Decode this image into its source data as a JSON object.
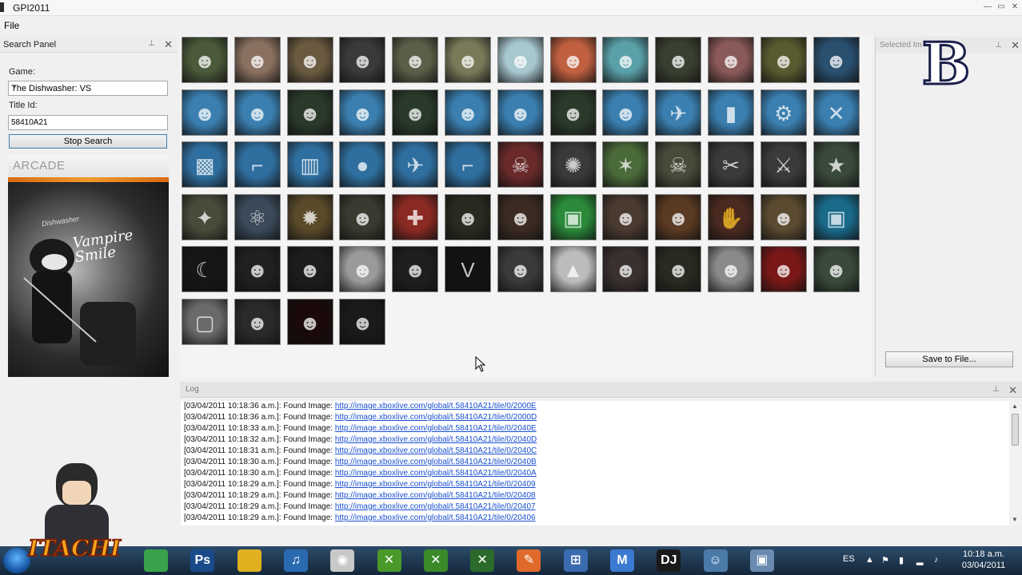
{
  "window": {
    "title": "GPI2011"
  },
  "menu": {
    "file": "File"
  },
  "search_panel": {
    "title": "Search Panel",
    "game_label": "Game:",
    "game_value": "The Dishwasher: VS",
    "titleid_label": "Title Id:",
    "titleid_value": "58410A21",
    "stop_button": "Stop Search",
    "arcade_label": "ARCADE",
    "art_text": "Vampire Smile",
    "art_caption": "Dishwasher"
  },
  "selected_panel": {
    "title": "Selected Im",
    "save_button": "Save to File...",
    "logo": "B"
  },
  "log_panel": {
    "title": "Log",
    "entries": [
      {
        "ts": "[03/04/2011 10:18:36 a.m.]: Found Image: ",
        "url": "http://image.xboxlive.com/global/t.58410A21/tile/0/2000E"
      },
      {
        "ts": "[03/04/2011 10:18:36 a.m.]: Found Image: ",
        "url": "http://image.xboxlive.com/global/t.58410A21/tile/0/2000D"
      },
      {
        "ts": "[03/04/2011 10:18:33 a.m.]: Found Image: ",
        "url": "http://image.xboxlive.com/global/t.58410A21/tile/0/2040E"
      },
      {
        "ts": "[03/04/2011 10:18:32 a.m.]: Found Image: ",
        "url": "http://image.xboxlive.com/global/t.58410A21/tile/0/2040D"
      },
      {
        "ts": "[03/04/2011 10:18:31 a.m.]: Found Image: ",
        "url": "http://image.xboxlive.com/global/t.58410A21/tile/0/2040C"
      },
      {
        "ts": "[03/04/2011 10:18:30 a.m.]: Found Image: ",
        "url": "http://image.xboxlive.com/global/t.58410A21/tile/0/2040B"
      },
      {
        "ts": "[03/04/2011 10:18:30 a.m.]: Found Image: ",
        "url": "http://image.xboxlive.com/global/t.58410A21/tile/0/2040A"
      },
      {
        "ts": "[03/04/2011 10:18:29 a.m.]: Found Image: ",
        "url": "http://image.xboxlive.com/global/t.58410A21/tile/0/20409"
      },
      {
        "ts": "[03/04/2011 10:18:29 a.m.]: Found Image: ",
        "url": "http://image.xboxlive.com/global/t.58410A21/tile/0/20408"
      },
      {
        "ts": "[03/04/2011 10:18:29 a.m.]: Found Image: ",
        "url": "http://image.xboxlive.com/global/t.58410A21/tile/0/20407"
      },
      {
        "ts": "[03/04/2011 10:18:29 a.m.]: Found Image: ",
        "url": "http://image.xboxlive.com/global/t.58410A21/tile/0/20406"
      }
    ]
  },
  "tiles": [
    [
      "#4a5a3a",
      "#8a7060",
      "#6a5a40",
      "#3a3a38",
      "#5a6048",
      "#7a7a5a",
      "#a8c8d0",
      "#c06040",
      "#5aa0a8",
      "#3a4030",
      "#8a5a58",
      "#5a5a30",
      "#2a5070"
    ],
    [
      "#3a7fb0",
      "#3a7fb0",
      "#2a3a2a",
      "#3a7fb0",
      "#2a3a2a",
      "#3a7fb0",
      "#3a7fb0",
      "#2a3a2a",
      "#3a7fb0",
      "#3a7fb0",
      "#3a7fb0",
      "#3a7fb0",
      "#3a7fb0"
    ],
    [
      "#2f6f9f",
      "#2f6f9f",
      "#2f6f9f",
      "#2f6f9f",
      "#2f6f9f",
      "#2f6f9f",
      "#6a2a2a",
      "#3a3a3a",
      "#4a6a3a",
      "#4a4a3a",
      "#3a3a3a",
      "#3a3a3a",
      "#3a4a3a"
    ],
    [
      "#4a4a3a",
      "#3a4a5a",
      "#5a4a2a",
      "#3a3a30",
      "#8a2a22",
      "#2a2a20",
      "#3a2a22",
      "#2a8a3a",
      "#4a3a30",
      "#5a3a22",
      "#4a2a20",
      "#5a4a30",
      "#1a6a8a"
    ],
    [
      "#161616",
      "#202020",
      "#1c1c1c",
      "#9a9a9a",
      "#1e1e1e",
      "#121212",
      "#3a3a3a",
      "#bcbcbc",
      "#3a3030",
      "#2a2a22",
      "#8a8a8a",
      "#7a1818",
      "#3a4a3a"
    ],
    [
      "#6a6a6a",
      "#2a2a2a",
      "#1a0a0a",
      "#1a1a1a"
    ]
  ],
  "tile_glyphs": [
    [
      "☻",
      "☻",
      "☻",
      "☻",
      "☻",
      "☻",
      "☻",
      "☻",
      "☻",
      "☻",
      "☻",
      "☻",
      "☻"
    ],
    [
      "☻",
      "☻",
      "☻",
      "☻",
      "☻",
      "☻",
      "☻",
      "☻",
      "☻",
      "✈",
      "▮",
      "⚙",
      "✕"
    ],
    [
      "▩",
      "⌐",
      "▥",
      "●",
      "✈",
      "⌐",
      "☠",
      "✺",
      "✶",
      "☠",
      "✂",
      "⚔",
      "★"
    ],
    [
      "✦",
      "⚛",
      "✹",
      "☻",
      "✚",
      "☻",
      "☻",
      "▣",
      "☻",
      "☻",
      "✋",
      "☻",
      "▣"
    ],
    [
      "☾",
      "☻",
      "☻",
      "☻",
      "☻",
      "V",
      "☻",
      "▲",
      "☻",
      "☻",
      "☻",
      "☻",
      "☻"
    ],
    [
      "▢",
      "☻",
      "☻",
      "☻"
    ]
  ],
  "taskbar": {
    "language": "ES",
    "clock_time": "10:18 a.m.",
    "clock_date": "03/04/2011",
    "apps": [
      {
        "name": "chrome",
        "label": "",
        "color": "#3aa24a"
      },
      {
        "name": "photoshop",
        "label": "Ps",
        "color": "#1a4a8a"
      },
      {
        "name": "bird-app",
        "label": "",
        "color": "#e0b020"
      },
      {
        "name": "itunes",
        "label": "♫",
        "color": "#2a6ab0"
      },
      {
        "name": "controller",
        "label": "◉",
        "color": "#c8c8c8"
      },
      {
        "name": "xbox-1",
        "label": "✕",
        "color": "#4a9a2a"
      },
      {
        "name": "xbox-2",
        "label": "✕",
        "color": "#3a8a2a"
      },
      {
        "name": "xbox-3",
        "label": "✕",
        "color": "#2a6a2a"
      },
      {
        "name": "paint-app",
        "label": "✎",
        "color": "#e06a2a"
      },
      {
        "name": "windows-app",
        "label": "⊞",
        "color": "#3a6ab0"
      },
      {
        "name": "m-app",
        "label": "M",
        "color": "#3a7ad0"
      },
      {
        "name": "dj-app",
        "label": "DJ",
        "color": "#1a1a1a"
      },
      {
        "name": "users-app",
        "label": "☺",
        "color": "#4a7aa8"
      },
      {
        "name": "gpi-app",
        "label": "▣",
        "color": "#6a8ab0"
      }
    ]
  },
  "avatar": {
    "name": "ITACHI"
  }
}
